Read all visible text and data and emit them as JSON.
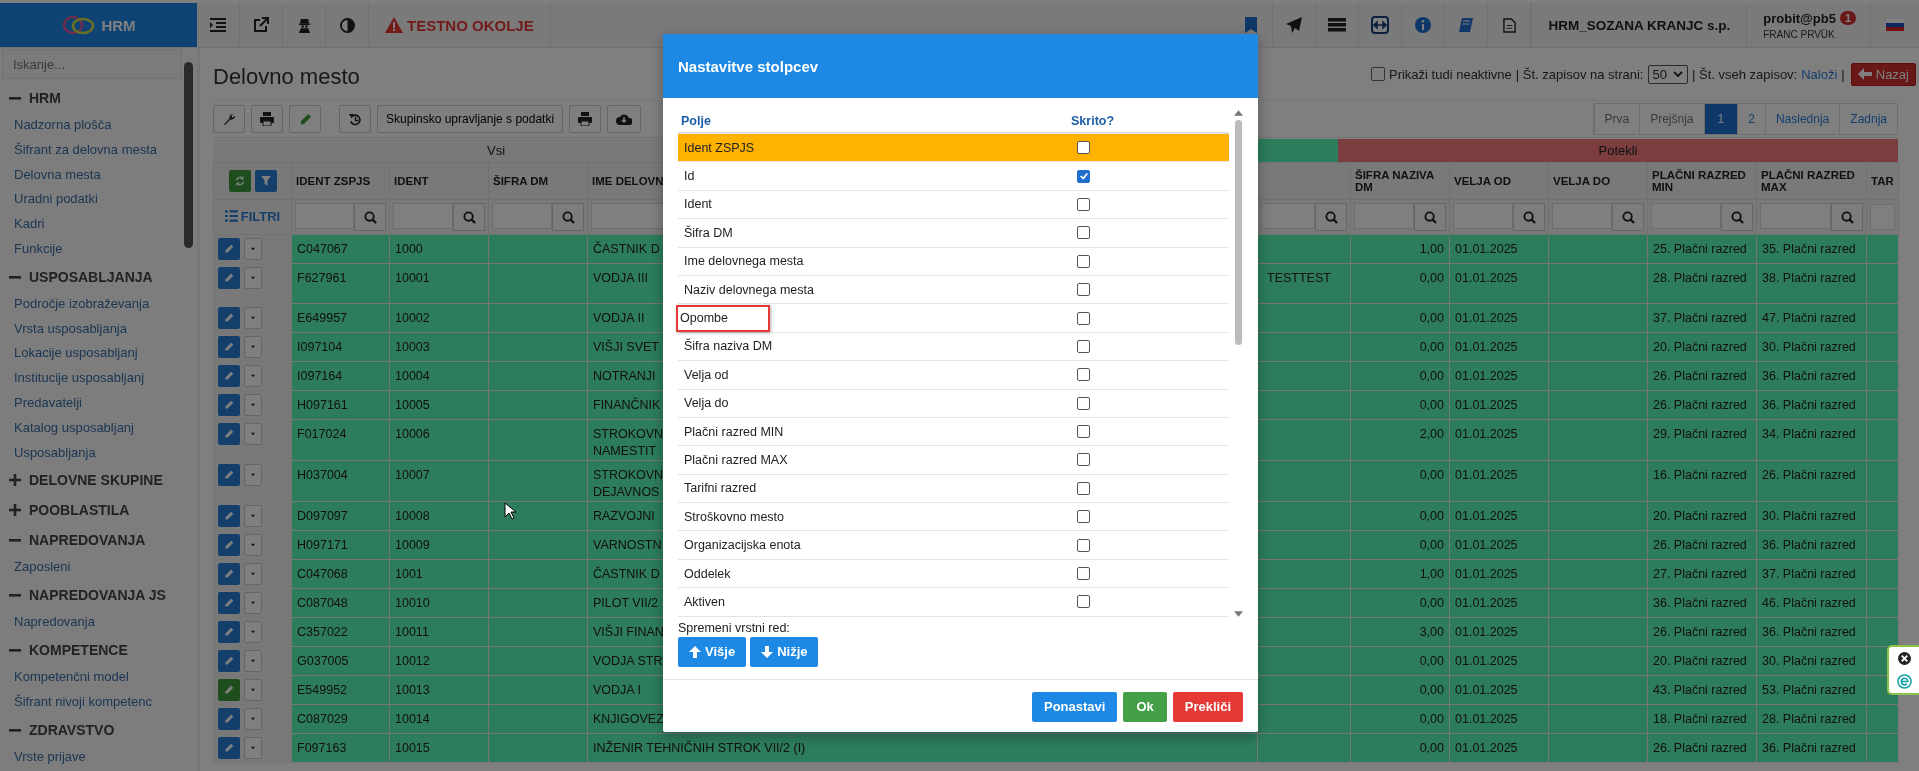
{
  "topbar": {
    "logo": "HRM",
    "environment": "TESTNO OKOLJE",
    "company": "HRM_SOZANA KRANJC s.p.",
    "user": "probit@pb5",
    "notifications": "1",
    "user_name": "FRANC PRVÜK"
  },
  "sidebar": {
    "search_placeholder": "Iskanje...",
    "groups": [
      {
        "label": "HRM",
        "expanded": true,
        "children": [
          {
            "label": "Nadzorna plošča"
          },
          {
            "label": "Šifrant za delovna mesta"
          },
          {
            "label": "Delovna mesta"
          },
          {
            "label": "Uradni podatki"
          },
          {
            "label": "Kadri"
          },
          {
            "label": "Funkcije"
          }
        ]
      },
      {
        "label": "USPOSABLJANJA",
        "expanded": true,
        "children": [
          {
            "label": "Področje izobraževanja"
          },
          {
            "label": "Vrsta usposabljanja"
          },
          {
            "label": "Lokacije usposabljanj"
          },
          {
            "label": "Institucije usposabljanj"
          },
          {
            "label": "Predavatelji"
          },
          {
            "label": "Katalog usposabljanj"
          },
          {
            "label": "Usposabljanja"
          }
        ]
      },
      {
        "label": "DELOVNE SKUPINE",
        "expanded": false
      },
      {
        "label": "POOBLASTILA",
        "expanded": false
      },
      {
        "label": "NAPREDOVANJA",
        "expanded": true,
        "children": [
          {
            "label": "Zaposleni"
          }
        ]
      },
      {
        "label": "NAPREDOVANJA JS",
        "expanded": true,
        "children": [
          {
            "label": "Napredovanja"
          }
        ]
      },
      {
        "label": "KOMPETENCE",
        "expanded": true,
        "children": [
          {
            "label": "Kompetenčni model"
          },
          {
            "label": "Šifrant nivoji kompetenc"
          }
        ]
      },
      {
        "label": "ZDRAVSTVO",
        "expanded": true,
        "children": [
          {
            "label": "Vrste prijave"
          }
        ]
      }
    ]
  },
  "page": {
    "title": "Delovno mesto",
    "show_inactive": {
      "label": "Prikaži tudi neaktivne",
      "checked": false
    },
    "per_page_label": "| Št. zapisov na strani:",
    "per_page": "50",
    "total_label": "| Št. vseh zapisov:",
    "load_link": "Naloži",
    "separator": "|",
    "back_button": "Nazaj"
  },
  "toolbar": {
    "group_button": "Skupinsko upravljanje s podatki"
  },
  "pagination": [
    {
      "label": "Prva",
      "selected": false,
      "disabled": true
    },
    {
      "label": "Prejšnja",
      "selected": false,
      "disabled": true
    },
    {
      "label": "1",
      "selected": true,
      "disabled": false
    },
    {
      "label": "2",
      "selected": false,
      "disabled": false
    },
    {
      "label": "Naslednja",
      "selected": false,
      "disabled": false
    },
    {
      "label": "Zadnja",
      "selected": false,
      "disabled": false
    }
  ],
  "table": {
    "filter_label": "FILTRI",
    "bands": [
      {
        "label": "Vsi",
        "kind": "plain"
      },
      {
        "kind": "positive"
      },
      {
        "label": "Potekli",
        "kind": "negative"
      }
    ],
    "columns": [
      {
        "label": "IDENT ZSPJS"
      },
      {
        "label": "IDENT"
      },
      {
        "label": "ŠIFRA DM"
      },
      {
        "label": "IME DELOVN"
      },
      null,
      {
        "label": "ŠIFRA NAZIVA DM"
      },
      {
        "label": "VELJA OD"
      },
      {
        "label": "VELJA DO"
      },
      {
        "label": "PLAČNI RAZRED MIN"
      },
      {
        "label": "PLAČNI RAZRED MAX"
      },
      {
        "label": "TAR"
      }
    ],
    "rows": [
      {
        "kind": "primary",
        "cells": [
          "C047067",
          "1000",
          null,
          "ČASTNIK D",
          null,
          "1,00",
          "01.01.2025",
          null,
          "25. Plačni razred",
          "35. Plačni razred",
          null
        ]
      },
      {
        "kind": "primary",
        "cells": [
          "F627961",
          "10001",
          null,
          "VODJA III",
          "TESTTEST",
          "0,00",
          "01.01.2025",
          null,
          "28. Plačni razred",
          "38. Plačni razred",
          null
        ],
        "tall": true
      },
      {
        "kind": "primary",
        "cells": [
          "E649957",
          "10002",
          null,
          "VODJA II",
          null,
          "0,00",
          "01.01.2025",
          null,
          "37. Plačni razred",
          "47. Plačni razred",
          null
        ]
      },
      {
        "kind": "primary",
        "cells": [
          "I097104",
          "10003",
          null,
          "VIŠJI SVET",
          null,
          "0,00",
          "01.01.2025",
          null,
          "20. Plačni razred",
          "30. Plačni razred",
          null
        ]
      },
      {
        "kind": "primary",
        "cells": [
          "I097164",
          "10004",
          null,
          "NOTRANJI",
          null,
          "0,00",
          "01.01.2025",
          null,
          "26. Plačni razred",
          "36. Plačni razred",
          null
        ]
      },
      {
        "kind": "primary",
        "cells": [
          "H097161",
          "10005",
          null,
          "FINANČNIK",
          null,
          "0,00",
          "01.01.2025",
          null,
          "26. Plačni razred",
          "36. Plačni razred",
          null
        ]
      },
      {
        "kind": "primary",
        "cells": [
          "F017024",
          "10006",
          null,
          "STROKOVN\nNAMESTIT",
          null,
          "2,00",
          "01.01.2025",
          null,
          "29. Plačni razred",
          "34. Plačni razred",
          null
        ],
        "tall": true
      },
      {
        "kind": "primary",
        "cells": [
          "H037004",
          "10007",
          null,
          "STROKOVN\nDEJAVNOS",
          null,
          "0,00",
          "01.01.2025",
          null,
          "16. Plačni razred",
          "26. Plačni razred",
          null
        ],
        "tall": true
      },
      {
        "kind": "primary",
        "cells": [
          "D097097",
          "10008",
          null,
          "RAZVOJNI",
          null,
          "0,00",
          "01.01.2025",
          null,
          "20. Plačni razred",
          "30. Plačni razred",
          null
        ]
      },
      {
        "kind": "primary",
        "cells": [
          "H097171",
          "10009",
          null,
          "VARNOSTN",
          null,
          "0,00",
          "01.01.2025",
          null,
          "26. Plačni razred",
          "36. Plačni razred",
          null
        ]
      },
      {
        "kind": "primary",
        "cells": [
          "C047068",
          "1001",
          null,
          "ČASTNIK D",
          null,
          "1,00",
          "01.01.2025",
          null,
          "27. Plačni razred",
          "37. Plačni razred",
          null
        ]
      },
      {
        "kind": "primary",
        "cells": [
          "C087048",
          "10010",
          null,
          "PILOT VII/2",
          null,
          "0,00",
          "01.01.2025",
          null,
          "36. Plačni razred",
          "46. Plačni razred",
          null
        ]
      },
      {
        "kind": "primary",
        "cells": [
          "C357022",
          "10011",
          null,
          "VIŠJI FINAN",
          null,
          "3,00",
          "01.01.2025",
          null,
          "26. Plačni razred",
          "36. Plačni razred",
          null
        ]
      },
      {
        "kind": "primary",
        "cells": [
          "G037005",
          "10012",
          null,
          "VODJA STR",
          null,
          "0,00",
          "01.01.2025",
          null,
          "20. Plačni razred",
          "30. Plačni razred",
          null
        ]
      },
      {
        "kind": "success",
        "cells": [
          "E549952",
          "10013",
          null,
          "VODJA I",
          null,
          "0,00",
          "01.01.2025",
          null,
          "43. Plačni razred",
          "53. Plačni razred",
          null
        ]
      },
      {
        "kind": "primary",
        "cells": [
          "C087029",
          "10014",
          null,
          "KNJIGOVEZ",
          null,
          "0,00",
          "01.01.2025",
          null,
          "18. Plačni razred",
          "28. Plačni razred",
          null
        ]
      },
      {
        "kind": "primary",
        "cells": [
          "F097163",
          "10015",
          null,
          "INŽENIR TEHNIČNIH STROK VII/2 (I)",
          null,
          "0,00",
          "01.01.2025",
          null,
          "26. Plačni razred",
          "36. Plačni razred",
          null
        ]
      }
    ]
  },
  "modal": {
    "title": "Nastavitve stolpcev",
    "field_header": "Polje",
    "hidden_header": "Skrito?",
    "fields": [
      {
        "label": "Ident ZSPJS",
        "hidden": false,
        "selected": true,
        "marked": false
      },
      {
        "label": "Id",
        "hidden": true,
        "selected": false,
        "marked": false
      },
      {
        "label": "Ident",
        "hidden": false,
        "selected": false,
        "marked": false
      },
      {
        "label": "Šifra DM",
        "hidden": false,
        "selected": false,
        "marked": false
      },
      {
        "label": "Ime delovnega mesta",
        "hidden": false,
        "selected": false,
        "marked": false
      },
      {
        "label": "Naziv delovnega mesta",
        "hidden": false,
        "selected": false,
        "marked": false
      },
      {
        "label": "Opombe",
        "hidden": false,
        "selected": false,
        "marked": true
      },
      {
        "label": "Šifra naziva DM",
        "hidden": false,
        "selected": false,
        "marked": false
      },
      {
        "label": "Velja od",
        "hidden": false,
        "selected": false,
        "marked": false
      },
      {
        "label": "Velja do",
        "hidden": false,
        "selected": false,
        "marked": false
      },
      {
        "label": "Plačni razred MIN",
        "hidden": false,
        "selected": false,
        "marked": false
      },
      {
        "label": "Plačni razred MAX",
        "hidden": false,
        "selected": false,
        "marked": false
      },
      {
        "label": "Tarifni razred",
        "hidden": false,
        "selected": false,
        "marked": false
      },
      {
        "label": "Stroškovno mesto",
        "hidden": false,
        "selected": false,
        "marked": false
      },
      {
        "label": "Organizacijska enota",
        "hidden": false,
        "selected": false,
        "marked": false
      },
      {
        "label": "Oddelek",
        "hidden": false,
        "selected": false,
        "marked": false
      },
      {
        "label": "Aktiven",
        "hidden": false,
        "selected": false,
        "marked": false
      }
    ],
    "order_label": "Spremeni vrstni red:",
    "up_button": "Višje",
    "down_button": "Nižje",
    "reset_button": "Ponastavi",
    "ok_button": "Ok",
    "cancel_button": "Prekliči"
  }
}
